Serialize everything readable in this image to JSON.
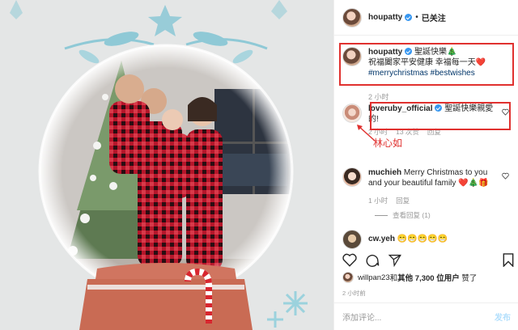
{
  "post": {
    "author": "houpatty",
    "follow_separator": "•",
    "follow_label": "已关注",
    "caption_user": "houpatty",
    "caption_line1": "聖誕快樂🎄",
    "caption_line2": "祝福闔家平安健康 幸福每一天❤️",
    "caption_tags": "#merrychristmas #bestwishes",
    "caption_time": "2 小时"
  },
  "comments": [
    {
      "user": "loveruby_official",
      "text_a": "聖誕快樂親愛",
      "text_b": "的!",
      "time": "2 小时",
      "likes": "13 次赞",
      "reply": "回复",
      "view_replies": ""
    },
    {
      "user": "muchieh",
      "text_a": "Merry Christmas to you",
      "text_b": "and your beautiful family ❤️🎄🎁",
      "time": "1 小时",
      "likes": "",
      "reply": "回复",
      "view_replies": "查看回复 (1)"
    },
    {
      "user": "cw.yeh",
      "text_a": "😁😁😁😁😁",
      "text_b": "",
      "time": "",
      "likes": "",
      "reply": "",
      "view_replies": ""
    }
  ],
  "annotation": "林心如",
  "likes_line": {
    "user": "willpan23",
    "mid": " 和 ",
    "others": "其他 7,300 位用户",
    "tail": "赞了"
  },
  "posted_time": "2 小时前",
  "add_comment": {
    "placeholder": "添加评论...",
    "post_label": "发布"
  },
  "colors": {
    "highlight_box": "#e0312f",
    "link": "#003569",
    "verified": "#3897f0"
  }
}
